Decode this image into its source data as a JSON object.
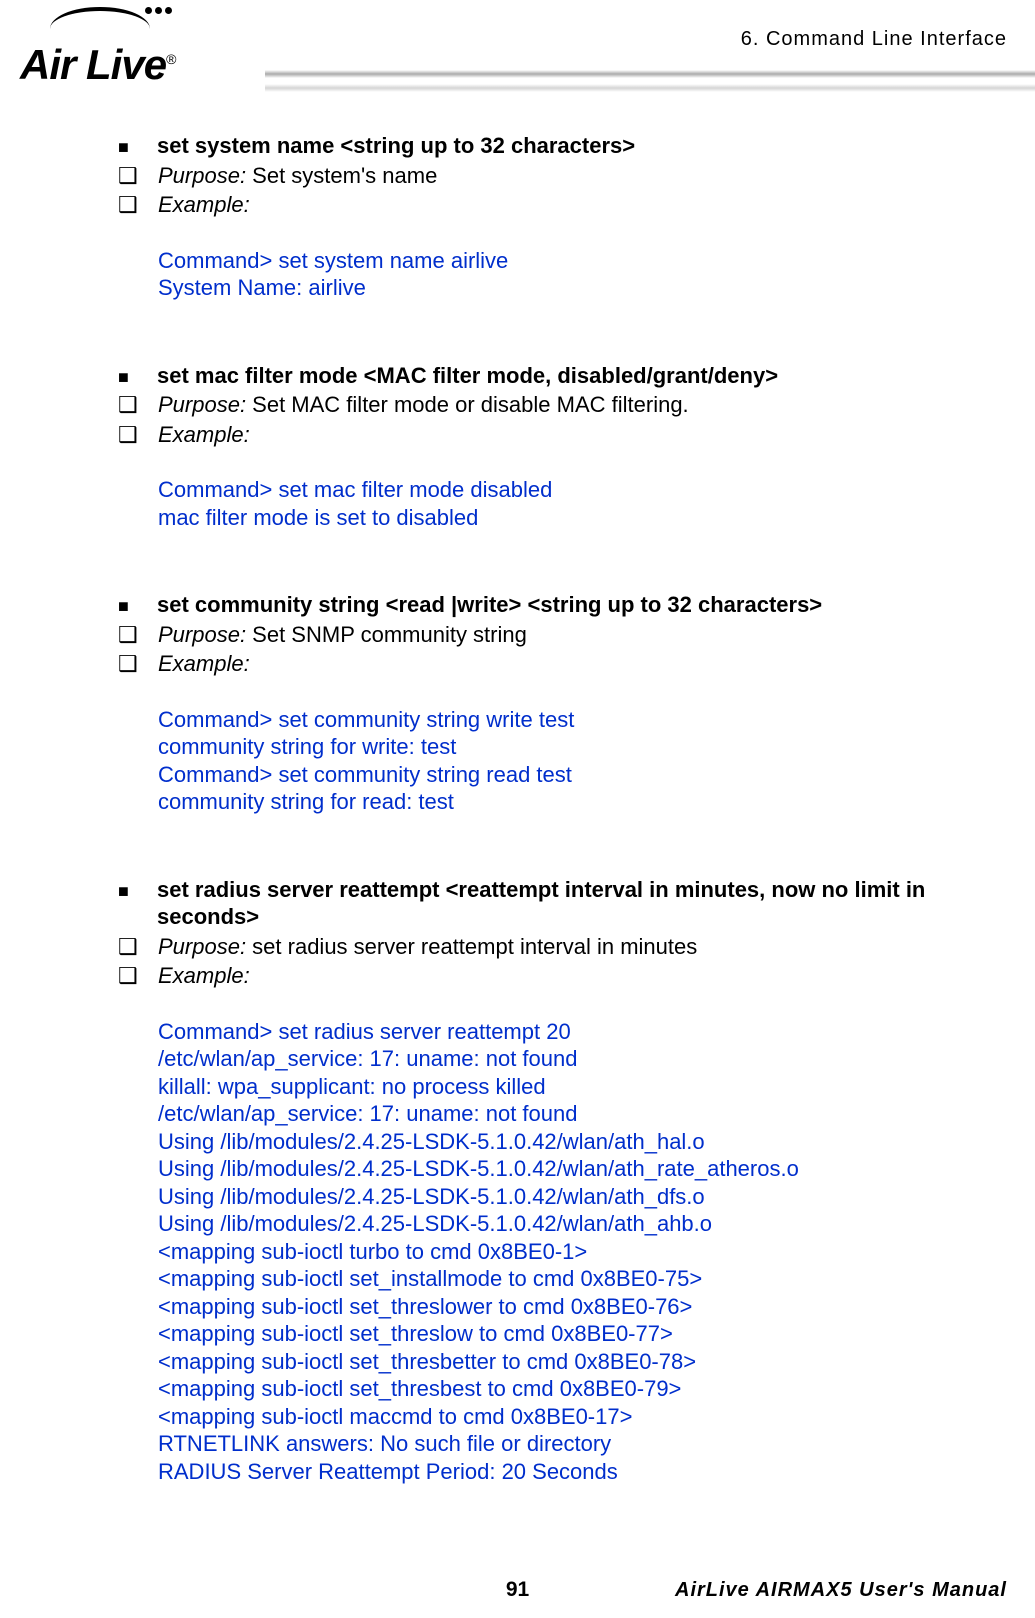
{
  "header": {
    "chapter": "6.  Command  Line  Interface"
  },
  "logo": {
    "brand": "Air Live",
    "reg": "®"
  },
  "sections": [
    {
      "title": "set system name <string up to 32 characters>",
      "purpose_label": "Purpose:",
      "purpose": " Set system's name",
      "example_label": "Example:",
      "lines": [
        "Command> set system name airlive",
        "System Name: airlive"
      ]
    },
    {
      "title": "set mac filter mode <MAC filter mode, disabled/grant/deny>",
      "purpose_label": "Purpose:",
      "purpose": " Set MAC filter mode or disable MAC filtering.",
      "example_label": "Example:",
      "lines": [
        "Command> set mac filter mode disabled",
        "mac filter mode is set to disabled"
      ]
    },
    {
      "title": "set community string <read |write> <string up to 32 characters>",
      "purpose_label": "Purpose:",
      "purpose": " Set SNMP community string",
      "example_label": "Example:",
      "lines": [
        "Command> set community string write test",
        "community string for write: test",
        "Command> set community string read test",
        "community string for read: test"
      ]
    },
    {
      "title": "set radius server reattempt <reattempt interval in minutes, now no limit in seconds>",
      "purpose_label": "Purpose:",
      "purpose": " set radius server reattempt interval in minutes",
      "example_label": "Example:",
      "lines": [
        "Command> set radius server reattempt 20",
        "/etc/wlan/ap_service: 17: uname: not found",
        "killall: wpa_supplicant: no process killed",
        "/etc/wlan/ap_service: 17: uname: not found",
        "Using /lib/modules/2.4.25-LSDK-5.1.0.42/wlan/ath_hal.o",
        "Using /lib/modules/2.4.25-LSDK-5.1.0.42/wlan/ath_rate_atheros.o",
        "Using /lib/modules/2.4.25-LSDK-5.1.0.42/wlan/ath_dfs.o",
        "Using /lib/modules/2.4.25-LSDK-5.1.0.42/wlan/ath_ahb.o",
        "<mapping sub-ioctl turbo to cmd 0x8BE0-1>",
        "<mapping sub-ioctl set_installmode to cmd 0x8BE0-75>",
        "<mapping sub-ioctl set_threslower to cmd 0x8BE0-76>",
        "<mapping sub-ioctl set_threslow to cmd 0x8BE0-77>",
        "<mapping sub-ioctl set_thresbetter to cmd 0x8BE0-78>",
        "<mapping sub-ioctl set_thresbest to cmd 0x8BE0-79>",
        "<mapping sub-ioctl maccmd to cmd 0x8BE0-17>",
        "RTNETLINK answers: No such file or directory",
        "RADIUS Server Reattempt Period: 20 Seconds"
      ]
    }
  ],
  "footer": {
    "page": "91",
    "right": "AirLive  AIRMAX5  User's  Manual"
  }
}
